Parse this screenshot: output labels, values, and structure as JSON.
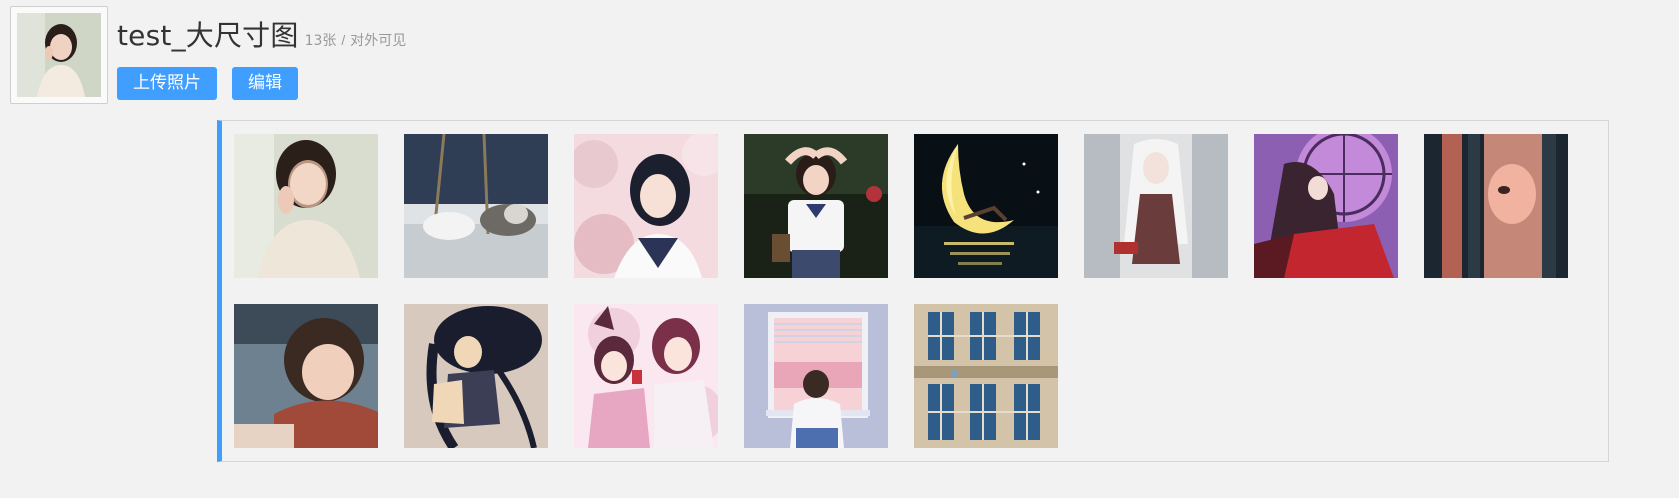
{
  "album": {
    "title": "test_大尺寸图",
    "count": "13张",
    "separator": "/",
    "visibility": "对外可见"
  },
  "actions": {
    "upload_label": "上传照片",
    "edit_label": "编辑"
  },
  "colors": {
    "accent": "#409eff",
    "background": "#f2f2f2",
    "panel_border": "#d6d6d6"
  },
  "photos": [
    {
      "name": "photo-1",
      "subject": "girl-knit-sweater",
      "colors": [
        "#d8ddd0",
        "#efe6da",
        "#c9a38f",
        "#8f9d86"
      ]
    },
    {
      "name": "photo-2",
      "subject": "cats-on-floor",
      "colors": [
        "#2f3d55",
        "#4a5a72",
        "#b8bcc0",
        "#dfe3e6"
      ]
    },
    {
      "name": "photo-3",
      "subject": "girl-sailor-cherry-blossom",
      "colors": [
        "#e8c9cf",
        "#f3dbe0",
        "#1c1f2e",
        "#2b3356"
      ]
    },
    {
      "name": "photo-4",
      "subject": "girl-school-uniform",
      "colors": [
        "#1a2218",
        "#2c3a28",
        "#f5f5f5",
        "#2e3b6e"
      ]
    },
    {
      "name": "photo-5",
      "subject": "moon-on-water",
      "colors": [
        "#081016",
        "#0f1b22",
        "#f6e27a",
        "#fff2a8"
      ]
    },
    {
      "name": "photo-6",
      "subject": "anime-white-hair",
      "colors": [
        "#dfe1e3",
        "#b7bcc2",
        "#6a3c3c",
        "#f4f4f4"
      ]
    },
    {
      "name": "photo-7",
      "subject": "anime-stained-glass",
      "colors": [
        "#8c5fb3",
        "#c28ad8",
        "#5b1a22",
        "#c3262f"
      ]
    },
    {
      "name": "photo-8",
      "subject": "girl-red-light",
      "colors": [
        "#1b2630",
        "#d9715c",
        "#f0a08a",
        "#2b3a45"
      ]
    },
    {
      "name": "photo-9",
      "subject": "girl-red-scarf",
      "colors": [
        "#27343e",
        "#6e8190",
        "#a24a3a",
        "#e6d3c4"
      ]
    },
    {
      "name": "photo-10",
      "subject": "anime-black-hat",
      "colors": [
        "#d7c9be",
        "#1a1d2e",
        "#f0d7b8",
        "#3b3e55"
      ]
    },
    {
      "name": "photo-11",
      "subject": "anime-fox-girls",
      "colors": [
        "#f1d0de",
        "#e7a6c2",
        "#5a2a3c",
        "#fbe7ef"
      ]
    },
    {
      "name": "photo-12",
      "subject": "girl-window-sunset",
      "colors": [
        "#b9bfd9",
        "#e9a6b9",
        "#f6d2d6",
        "#4d6fb0"
      ]
    },
    {
      "name": "photo-13",
      "subject": "building-windows",
      "colors": [
        "#c9b79c",
        "#2f5d8a",
        "#e0d4bf",
        "#7fa0b8"
      ]
    }
  ]
}
